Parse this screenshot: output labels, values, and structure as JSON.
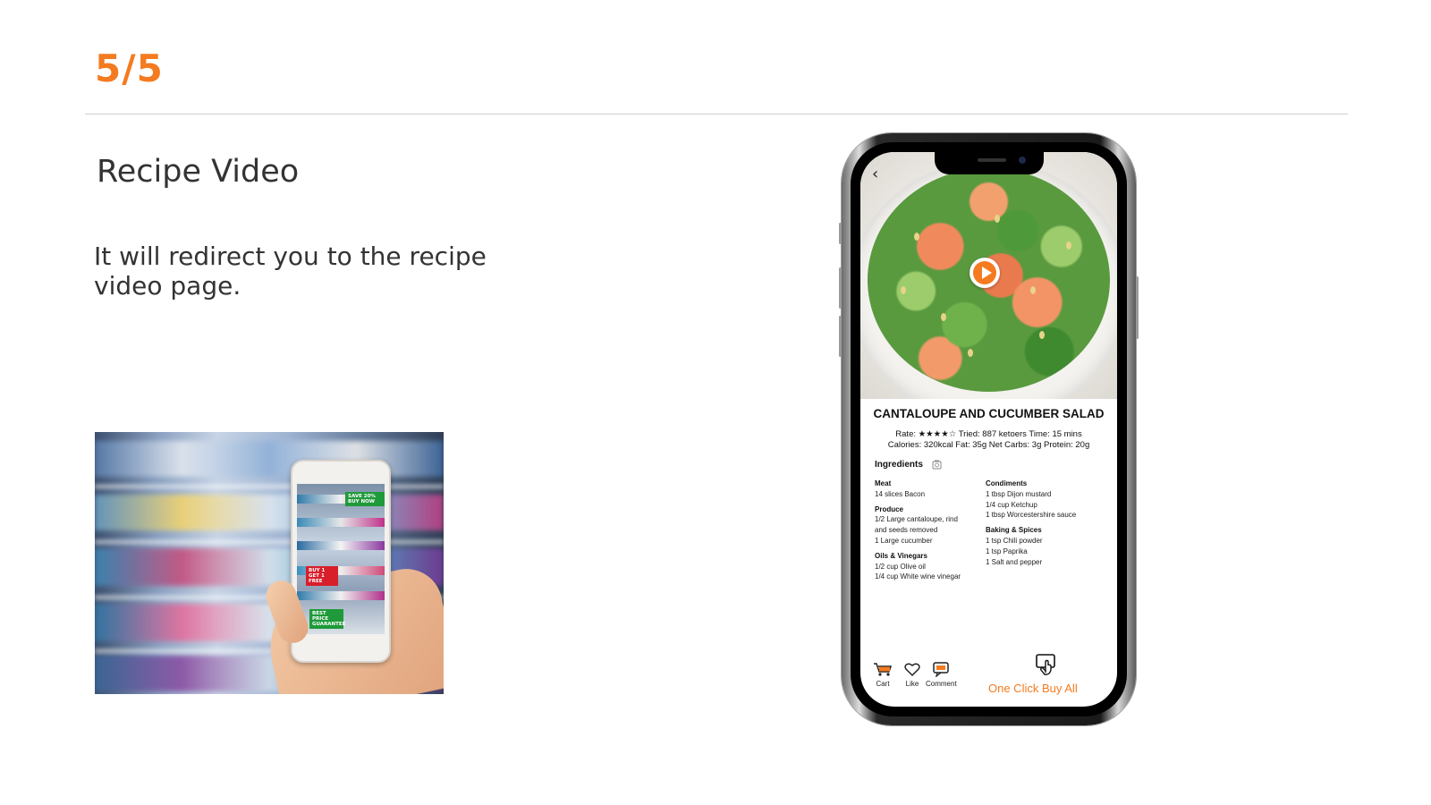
{
  "slide": {
    "step": "5/5",
    "title": "Recipe Video",
    "description": "It will redirect you to the recipe video page."
  },
  "store_photo": {
    "tags": [
      "SAVE 20% BUY NOW",
      "BUY 1 GET 1 FREE",
      "BEST PRICE GUARANTEE"
    ]
  },
  "recipe": {
    "title": "CANTALOUPE AND CUCUMBER SALAD",
    "rate_label": "Rate:",
    "rating": 4,
    "rating_max": 5,
    "stars": "★★★★☆",
    "tried_label": "Tried:",
    "tried_value": "887 ketoers",
    "time_label": "Time:",
    "time_value": "15 mins",
    "calories_line": "Calories: 320kcal  Fat: 35g  Net Carbs: 3g  Protein: 20g",
    "ingredients_heading": "Ingredients",
    "left_column": [
      {
        "heading": "Meat",
        "items": [
          "14 slices Bacon"
        ]
      },
      {
        "heading": "Produce",
        "items": [
          "1/2 Large cantaloupe, rind",
          "and seeds removed",
          "1 Large cucumber"
        ]
      },
      {
        "heading": "Oils & Vinegars",
        "items": [
          "1/2 cup Olive oil",
          "1/4 cup White wine vinegar"
        ]
      }
    ],
    "right_column": [
      {
        "heading": "Condiments",
        "items": [
          "1 tbsp Dijon mustard",
          "1/4 cup Ketchup",
          "1 tbsp Worcestershire sauce"
        ]
      },
      {
        "heading": "Baking & Spices",
        "items": [
          "1 tsp Chili powder",
          "1 tsp Paprika",
          "1 Salt and pepper"
        ]
      }
    ]
  },
  "tabbar": {
    "cart": "Cart",
    "like": "Like",
    "comment": "Comment",
    "buy_all": "One Click Buy All"
  },
  "colors": {
    "accent": "#f47b20",
    "text": "#333333",
    "rule": "#cfcfcf"
  }
}
